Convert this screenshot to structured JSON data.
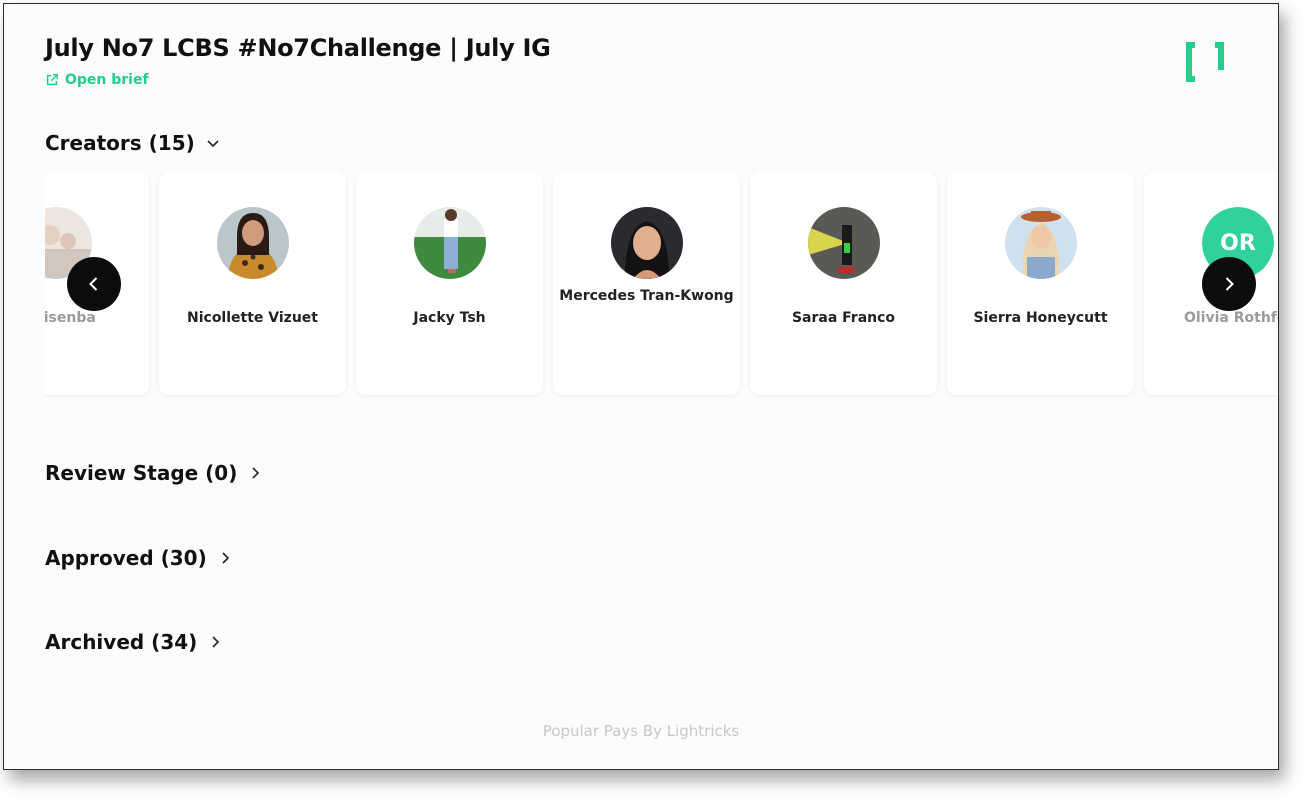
{
  "header": {
    "title": "July No7 LCBS #No7Challenge | July IG",
    "open_brief": "Open brief",
    "logo_icon": "brackets-logo",
    "accent_color": "#1fcf8a"
  },
  "sections": {
    "creators": "Creators (15)",
    "review_stage": "Review Stage (0)",
    "approved": "Approved (30)",
    "archived": "Archived (34)"
  },
  "creators": [
    {
      "name": "ni Lisenba",
      "avatar": "photo"
    },
    {
      "name": "Nicollette Vizuet",
      "avatar": "photo"
    },
    {
      "name": "Jacky Tsh",
      "avatar": "photo"
    },
    {
      "name": "Mercedes Tran-Kwong",
      "avatar": "photo"
    },
    {
      "name": "Saraa Franco",
      "avatar": "photo"
    },
    {
      "name": "Sierra Honeycutt",
      "avatar": "photo"
    },
    {
      "name": "Olivia Rothfel",
      "avatar": "initials",
      "initials": "OR"
    }
  ],
  "carousel": {
    "prev_icon": "chevron-left-icon",
    "next_icon": "chevron-right-icon"
  },
  "footer": {
    "text": "Popular Pays By Lightricks"
  }
}
